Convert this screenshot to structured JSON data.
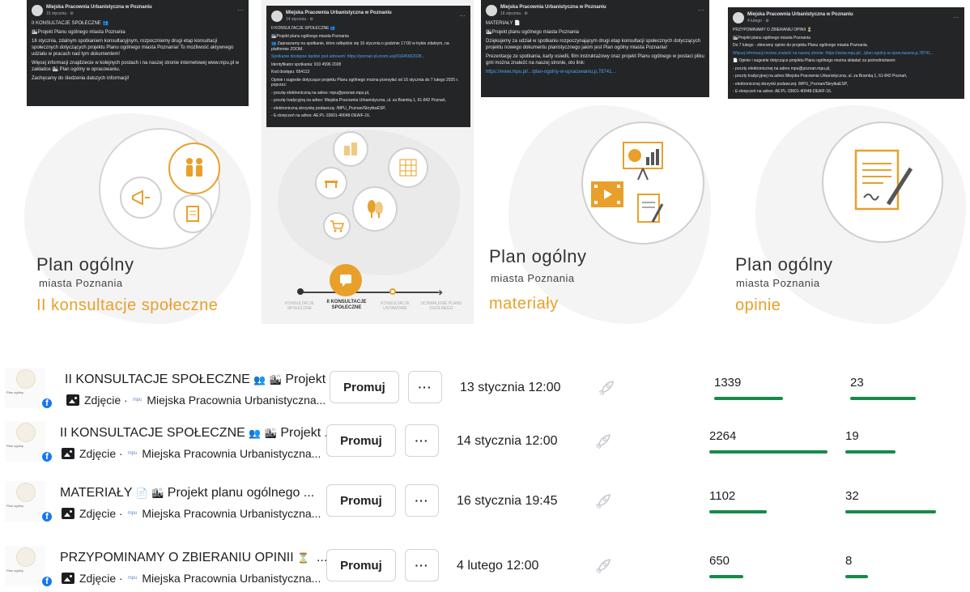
{
  "graphics": [
    {
      "post": {
        "page": "Miejska Pracownia Urbanistyczna w Poznaniu",
        "date": "15 stycznia · ⚙",
        "lines": [
          "II KONSULTACJE SPOŁECZNE 👥",
          "🏙Projekt Planu ogólnego miasta Poznania",
          "16 stycznia, zdalnym spotkaniem konsultacyjnym, rozpoczniemy drugi etap konsultacji społecznych dotyczących projektu Planu ogólnego miasta Poznania! To możliwość aktywnego udziału w pracach nad tym dokumentem!",
          "Więcej informacji znajdziecie w kolejnych postach i na naszej stronie internetowej www.mpu.pl w zakładce 🏙 Plan ogólny w opracowaniu.",
          "Zachęcamy do śledzenia dalszych informacji!"
        ]
      },
      "title": "Plan ogólny",
      "subtitle": "miasta Poznania",
      "accent": "II konsultacje społeczne"
    },
    {
      "post": {
        "page": "Miejska Pracownia Urbanistyczna w Poznaniu",
        "date": "14 stycznia · ⚙",
        "lines": [
          "II KONSULTACJE SPOŁECZNE 👥",
          "🏙Projekt planu ogólnego miasta Poznania",
          "👥 Zapraszamy na spotkanie, które odbędzie się 16 stycznia o godzinie 17:00 w trybie zdalnym, na platformie ZOOM.",
          "Spotkanie dostępne będzie pod adresem: https://poznan-pl.zoom.us/j/91045962028...",
          "Identyfikator spotkania: 910 4596 2028",
          "Kod dostępu: 654113",
          "Opinie i sugestie dotyczące projektu Planu ogólnego można przesyłać od 16 stycznia do 7 lutego 2025 r. poprzez:",
          "- pocztę elektroniczną na adres: mpu@poznan.mpu.pl,",
          "- pocztę tradycyjną na adres: Miejska Pracownia Urbanistyczna, ul. za Bramką 1, 61-842 Poznań,",
          "- elektroniczną skrzynkę podawczą: /MPU_Poznan/SkrytkaESP,",
          "- E-doręczeń na adres: AE:PL-33601-40048-DEAIF-16."
        ]
      },
      "timeline": {
        "steps": [
          "KONSULTACJE SPOŁECZNE",
          "II KONSULTACJE SPOŁECZNE",
          "KONSULTACJE USTAWOWE",
          "UCHWALENIE PLANU OGÓLNEGO"
        ]
      }
    },
    {
      "post": {
        "page": "Miejska Pracownia Urbanistyczna w Poznaniu",
        "date": "16 stycznia · ⚙",
        "lines": [
          "MATERIAŁY 📄",
          "🏙Projekt planu ogólnego miasta Poznania",
          "Dziękujemy za udział w spotkaniu rozpoczynającym drugi etap konsultacji społecznych dotyczących projektu nowego dokumentu planistycznego jakim jest Plan ogólny miasta Poznania!",
          "Prezentację ze spotkania, karty osiedli, film instruktażowy oraz projekt Planu ogólnego w postaci pliku gml można znaleźć na naszej stronie, oto link:",
          "https://www.mpu.pl/.../plan-ogolny-w-opracowaniu,p,78741..."
        ]
      },
      "title": "Plan ogólny",
      "subtitle": "miasta Poznania",
      "accent": "materiały"
    },
    {
      "post": {
        "page": "Miejska Pracownia Urbanistyczna w Poznaniu",
        "date": "4 lutego · ⚙",
        "lines": [
          "PRZYPOMINAMY O ZBIERANIU OPINII ⏳",
          "🏙Projekt planu ogólnego miasta Poznania",
          "Do 7 lutego - zbieramy opinie do projektu Planu ogólnego miasta Poznania.",
          "Więcej informacji można znaleźć na naszej stronie: https://www.mpu.pl/.../plan-ogolny-w-opracowaniu,p,78741...",
          "📄 Opinie i sugestie dotyczące projektu Planu ogólnego można składać za pośrednictwem:",
          "- poczty elektronicznej na adres mpu@poznan.mpu.pl,",
          "- poczty tradycyjnej na adres Miejska Pracownia Urbanistyczna, ul. za Bramką 1, 61-842 Poznań,",
          "- elektronicznej skrzynki podawczej: /MPU_Poznan/SkrytkaESP,",
          "- E-doręczeń na adres: AE:PL-33601-40048-DEAIF-16."
        ]
      },
      "title": "Plan ogólny",
      "subtitle": "miasta Poznania",
      "accent": "opinie"
    }
  ],
  "rows": [
    {
      "title": "II KONSULTACJE SPOŁECZNE",
      "title_suffix": "Projekt ...",
      "type": "Zdjęcie ·",
      "page": "Miejska Pracownia Urbanistyczna...",
      "promote": "Promuj",
      "more": "···",
      "date": "13 stycznia 12:00",
      "stat1": "1339",
      "stat1_fill": 0.5,
      "stat2": "23",
      "stat2_fill": 0.55
    },
    {
      "title": "II KONSULTACJE SPOŁECZNE",
      "title_suffix": "Projekt ...",
      "type": "Zdjęcie ·",
      "page": "Miejska Pracownia Urbanistyczna...",
      "promote": "Promuj",
      "more": "···",
      "date": "14 stycznia 12:00",
      "stat1": "2264",
      "stat1_fill": 0.88,
      "stat2": "19",
      "stat2_fill": 0.42
    },
    {
      "title": "MATERIAŁY",
      "title_suffix": "Projekt planu ogólnego ...",
      "type": "Zdjęcie ·",
      "page": "Miejska Pracownia Urbanistyczna...",
      "promote": "Promuj",
      "more": "···",
      "date": "16 stycznia 19:45",
      "stat1": "1102",
      "stat1_fill": 0.43,
      "stat2": "32",
      "stat2_fill": 0.76
    },
    {
      "title": "PRZYPOMINAMY O ZBIERANIU OPINII",
      "title_suffix": "...",
      "type": "Zdjęcie ·",
      "page": "Miejska Pracownia Urbanistyczna...",
      "promote": "Promuj",
      "more": "···",
      "date": "4 lutego 12:00",
      "stat1": "650",
      "stat1_fill": 0.25,
      "stat2": "8",
      "stat2_fill": 0.19
    }
  ],
  "small_logo": "mpu",
  "thumb_caption": "Plan ogólny",
  "colors": {
    "accent": "#e8a02a",
    "bar": "#178a49",
    "fb": "#1877f2",
    "post_bg": "#242526"
  }
}
